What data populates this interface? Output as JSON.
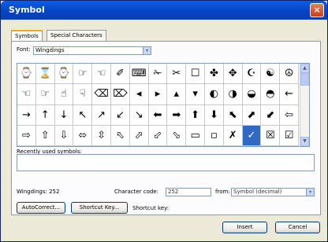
{
  "title": "Symbol",
  "close_glyph": "×",
  "tabs": [
    "Symbols",
    "Special Characters"
  ],
  "font_label": "Font:",
  "font_value": "Wingdings",
  "dropdown_glyph": "▾",
  "symbols": [
    [
      "⌚",
      "⌛",
      "⌚",
      "☞",
      "☜",
      "✐",
      "⌨",
      "✁",
      "✂",
      "☐",
      "✤",
      "✥",
      "☪",
      "☯",
      "☮"
    ],
    [
      "☜",
      "☞",
      "☝",
      "☟",
      "⌫",
      "⌦",
      "◂",
      "▸",
      "▴",
      "▾",
      "◐",
      "◑",
      "◒",
      "◓",
      "←"
    ],
    [
      "→",
      "↑",
      "↓",
      "↖",
      "↗",
      "↙",
      "↘",
      "⬅",
      "➡",
      "⬆",
      "⬇",
      "⬉",
      "⬈",
      "⬋",
      "⇦"
    ],
    [
      "⇨",
      "⇧",
      "⇩",
      "⬄",
      "⇳",
      "⬁",
      "⬀",
      "⬃",
      "⬂",
      "▭",
      "▫",
      "✗",
      "✓",
      "☒",
      "☑"
    ]
  ],
  "selected_symbol": "✓",
  "scroll_up_glyph": "▲",
  "scroll_down_glyph": "▼",
  "recent_label": "Recently used symbols:",
  "status_left": "Wingdings: 252",
  "char_code_label": "Character code:",
  "char_code_value": "252",
  "from_label": "from:",
  "from_value": "Symbol (decimal)",
  "autocorrect_label": "AutoCorrect...",
  "shortcut_key_button": "Shortcut Key...",
  "shortcut_key_label": "Shortcut key:",
  "insert_label": "Insert",
  "cancel_label": "Cancel"
}
